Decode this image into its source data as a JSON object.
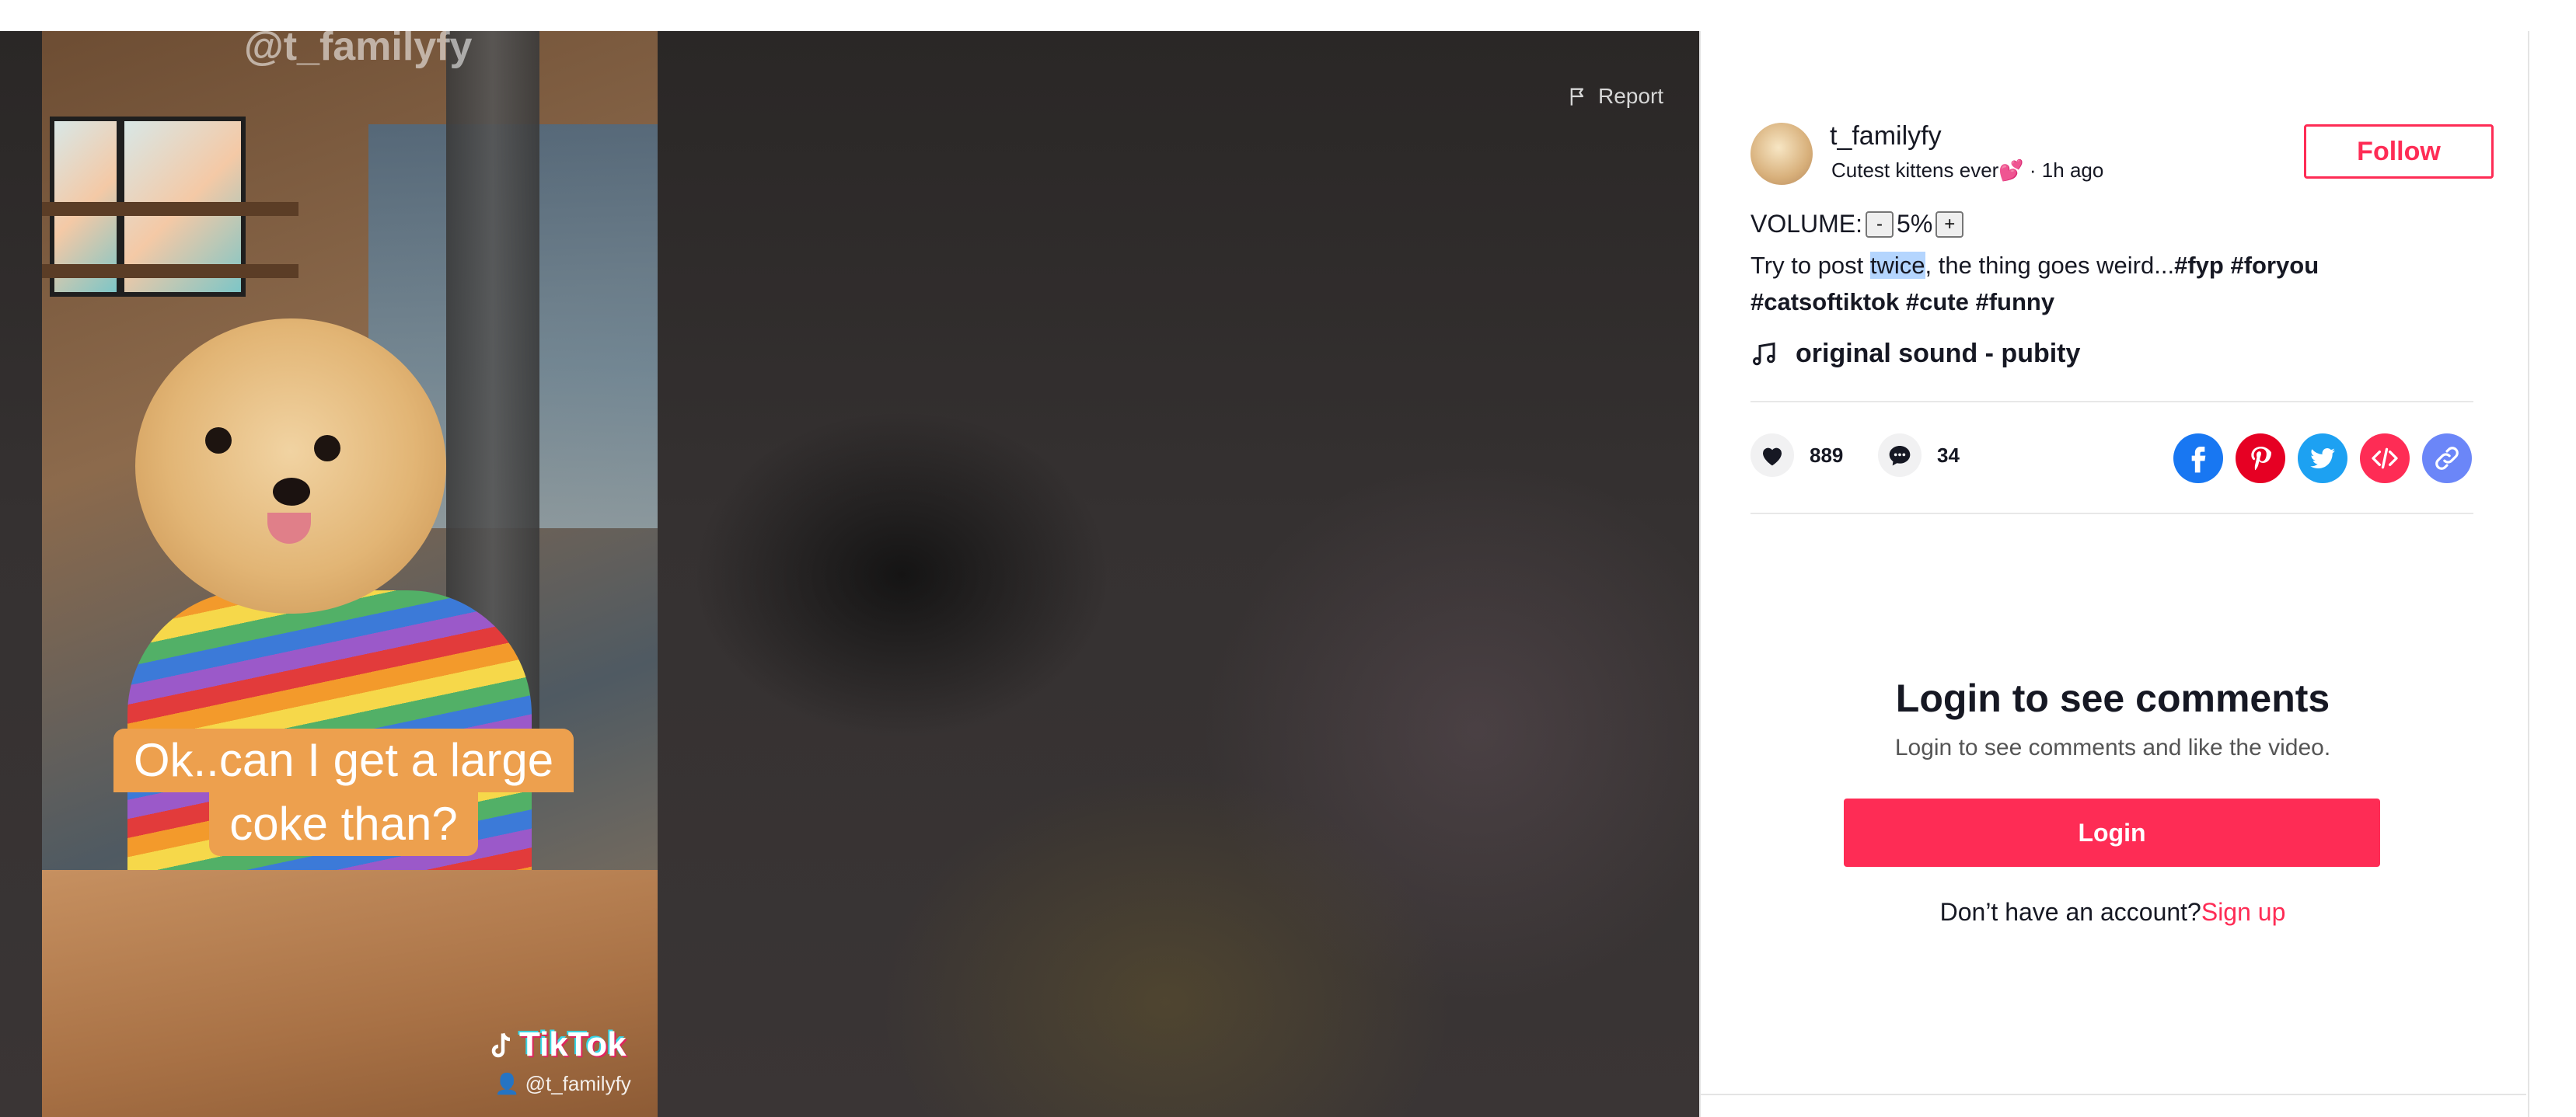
{
  "video": {
    "watermark_top": "@t_familyfy",
    "caption_line1": "Ok..can I get a large",
    "caption_line2": "coke than?",
    "tiktok_brand": "TikTok",
    "tiktok_user": "@t_familyfy",
    "report_label": "Report"
  },
  "author": {
    "username": "t_familyfy",
    "bio": "Cutest kittens ever💕",
    "time_separator": " · ",
    "time_ago": "1h ago",
    "follow_label": "Follow"
  },
  "volume": {
    "label": "VOLUME:",
    "minus": "-",
    "value": "5%",
    "plus": "+"
  },
  "description": {
    "pre": "Try to post ",
    "highlight": "twice",
    "post": ", the thing goes weird...",
    "tags": [
      "#fyp",
      "#foryou",
      "#catsoftiktok",
      "#cute",
      "#funny"
    ]
  },
  "sound": {
    "icon": "music-note-icon",
    "title": "original sound - pubity"
  },
  "stats": {
    "likes": "889",
    "comments": "34"
  },
  "share": {
    "icons": [
      "facebook-icon",
      "pinterest-icon",
      "twitter-icon",
      "embed-icon",
      "link-icon"
    ],
    "colors": {
      "facebook": "#1877f2",
      "pinterest": "#e60023",
      "twitter": "#1da1f2",
      "embed": "#fe2c55",
      "link": "#6b86f8"
    }
  },
  "login": {
    "title": "Login to see comments",
    "subtitle": "Login to see comments and like the video.",
    "button": "Login",
    "prompt": "Don’t have an account?",
    "signup": "Sign up"
  },
  "colors": {
    "accent": "#fe2c55",
    "caption_bg": "#eda04e",
    "text": "#161823"
  }
}
